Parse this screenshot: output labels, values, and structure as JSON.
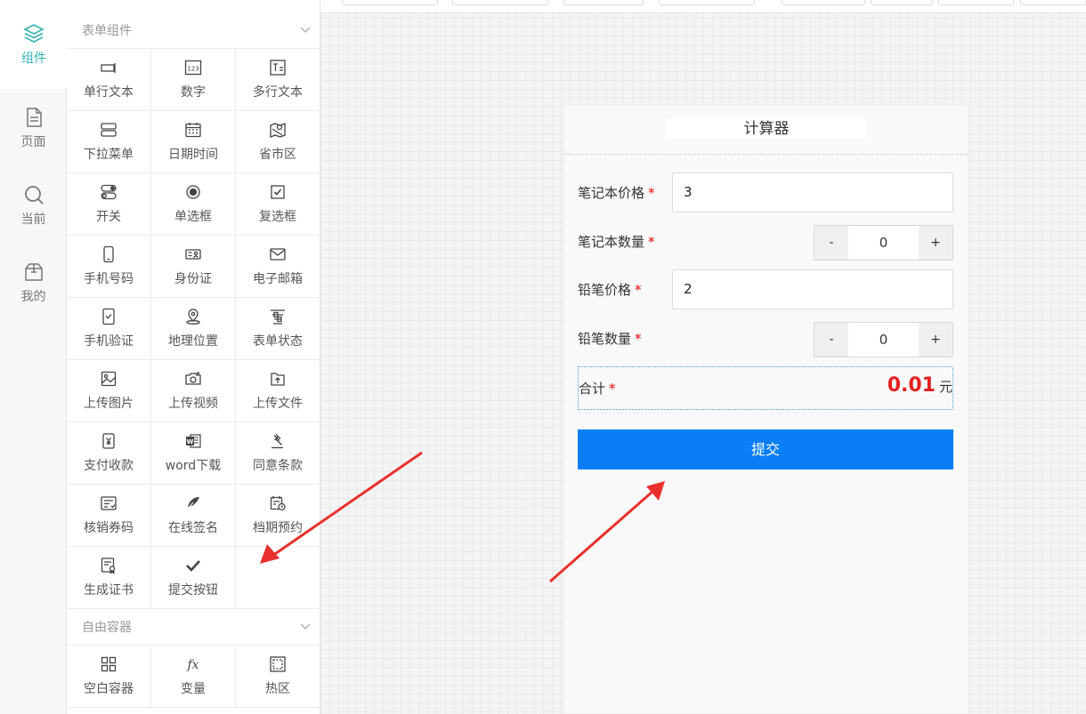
{
  "rail": {
    "items": [
      {
        "label": "组件",
        "icon": "layers-icon",
        "active": true
      },
      {
        "label": "页面",
        "icon": "document-icon",
        "active": false
      },
      {
        "label": "当前",
        "icon": "search-icon",
        "active": false
      },
      {
        "label": "我的",
        "icon": "box-icon",
        "active": false
      }
    ]
  },
  "panel": {
    "form_section_title": "表单组件",
    "form_components": [
      {
        "label": "单行文本",
        "icon": "single-line-text-icon"
      },
      {
        "label": "数字",
        "icon": "number-icon"
      },
      {
        "label": "多行文本",
        "icon": "multi-line-text-icon"
      },
      {
        "label": "下拉菜单",
        "icon": "dropdown-icon"
      },
      {
        "label": "日期时间",
        "icon": "calendar-icon"
      },
      {
        "label": "省市区",
        "icon": "map-region-icon"
      },
      {
        "label": "开关",
        "icon": "switch-icon"
      },
      {
        "label": "单选框",
        "icon": "radio-icon"
      },
      {
        "label": "复选框",
        "icon": "checkbox-icon"
      },
      {
        "label": "手机号码",
        "icon": "mobile-icon"
      },
      {
        "label": "身份证",
        "icon": "id-card-icon"
      },
      {
        "label": "电子邮箱",
        "icon": "email-icon"
      },
      {
        "label": "手机验证",
        "icon": "mobile-verify-icon"
      },
      {
        "label": "地理位置",
        "icon": "location-icon"
      },
      {
        "label": "表单状态",
        "icon": "form-status-icon"
      },
      {
        "label": "上传图片",
        "icon": "image-upload-icon"
      },
      {
        "label": "上传视频",
        "icon": "camera-icon"
      },
      {
        "label": "上传文件",
        "icon": "file-upload-icon"
      },
      {
        "label": "支付收款",
        "icon": "payment-icon"
      },
      {
        "label": "word下载",
        "icon": "word-icon"
      },
      {
        "label": "同意条款",
        "icon": "gavel-icon"
      },
      {
        "label": "核销券码",
        "icon": "coupon-icon"
      },
      {
        "label": "在线签名",
        "icon": "feather-icon"
      },
      {
        "label": "档期预约",
        "icon": "schedule-icon"
      },
      {
        "label": "生成证书",
        "icon": "certificate-icon"
      },
      {
        "label": "提交按钮",
        "icon": "check-icon"
      }
    ],
    "container_section_title": "自由容器",
    "container_components": [
      {
        "label": "空白容器",
        "icon": "grid-icon"
      },
      {
        "label": "变量",
        "icon": "fx-icon"
      },
      {
        "label": "热区",
        "icon": "hotspot-icon"
      }
    ]
  },
  "phone": {
    "title": "计算器",
    "fields": {
      "laptop_price_label": "笔记本价格",
      "laptop_price_value": "3",
      "laptop_qty_label": "笔记本数量",
      "laptop_qty_value": "0",
      "pencil_price_label": "铅笔价格",
      "pencil_price_value": "2",
      "pencil_qty_label": "铅笔数量",
      "pencil_qty_value": "0",
      "total_label": "合计",
      "total_value": "0.01",
      "total_unit": "元",
      "required_mark": "*",
      "minus": "-",
      "plus": "+"
    },
    "submit_label": "提交"
  },
  "colors": {
    "accent": "#35b3b3",
    "submit": "#0a7ef5",
    "total": "#e41f1f",
    "arrow": "#e8312d"
  }
}
